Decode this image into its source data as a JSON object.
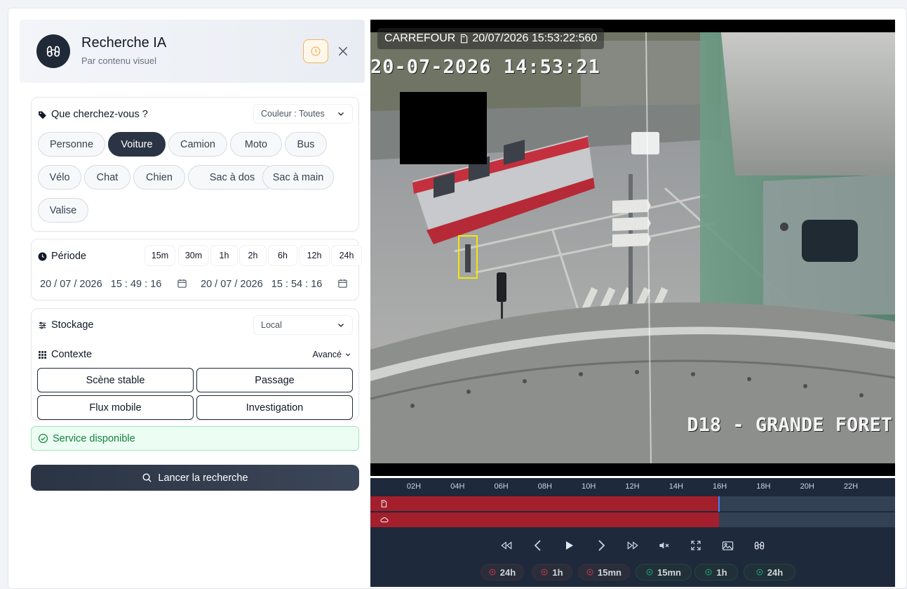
{
  "header": {
    "title": "Recherche IA",
    "subtitle": "Par contenu visuel",
    "icon": "binoculars-icon"
  },
  "search": {
    "title": "Que cherchez-vous ?",
    "color_filter": "Couleur : Toutes",
    "objects": [
      {
        "label": "Personne",
        "active": false
      },
      {
        "label": "Voiture",
        "active": true
      },
      {
        "label": "Camion",
        "active": false
      },
      {
        "label": "Moto",
        "active": false
      },
      {
        "label": "Bus",
        "active": false
      },
      {
        "label": "Vélo",
        "active": false
      },
      {
        "label": "Chat",
        "active": false
      },
      {
        "label": "Chien",
        "active": false
      },
      {
        "label": "Sac à dos",
        "active": false
      },
      {
        "label": "Sac à main",
        "active": false
      },
      {
        "label": "Valise",
        "active": false
      }
    ]
  },
  "period": {
    "title": "Période",
    "presets": [
      "15m",
      "30m",
      "1h",
      "2h",
      "6h",
      "12h",
      "24h"
    ],
    "start": "20 / 07 / 2026   15 : 49 : 16",
    "end": "20 / 07 / 2026   15 : 54 : 16"
  },
  "storage": {
    "title": "Stockage",
    "value": "Local"
  },
  "context": {
    "title": "Contexte",
    "mode": "Avancé",
    "buttons": [
      "Scène stable",
      "Passage",
      "Flux mobile",
      "Investigation"
    ]
  },
  "status": {
    "text": "Service disponible",
    "color": "#15803d"
  },
  "launch": {
    "label": "Lancer la recherche"
  },
  "video": {
    "overlay": "CARREFOUR",
    "overlay_time": "20/07/2026 15:53:22:560",
    "osd_time": "20-07-2026 14:53:21",
    "osd_location": "D18 - GRANDE FORET"
  },
  "timeline": {
    "hours": [
      "02H",
      "04H",
      "06H",
      "08H",
      "10H",
      "12H",
      "14H",
      "16H",
      "18H",
      "20H",
      "22H"
    ],
    "recorded_until_fraction": 0.664,
    "tracks": [
      "sd-card-icon",
      "cloud-icon"
    ]
  },
  "controls": [
    "rewind-icon",
    "prev-icon",
    "play-icon",
    "next-icon",
    "fast-forward-icon",
    "mute-icon",
    "fullscreen-icon",
    "snapshot-icon",
    "binoculars-icon"
  ],
  "jumps": [
    {
      "label": "24h",
      "dir": "back"
    },
    {
      "label": "1h",
      "dir": "back"
    },
    {
      "label": "15mn",
      "dir": "back"
    },
    {
      "label": "15mn",
      "dir": "fwd"
    },
    {
      "label": "1h",
      "dir": "fwd"
    },
    {
      "label": "24h",
      "dir": "fwd"
    }
  ],
  "colors": {
    "accent": "#2b3444",
    "record": "#a31f2c",
    "success": "#15803d",
    "history": "#f0b35e"
  }
}
